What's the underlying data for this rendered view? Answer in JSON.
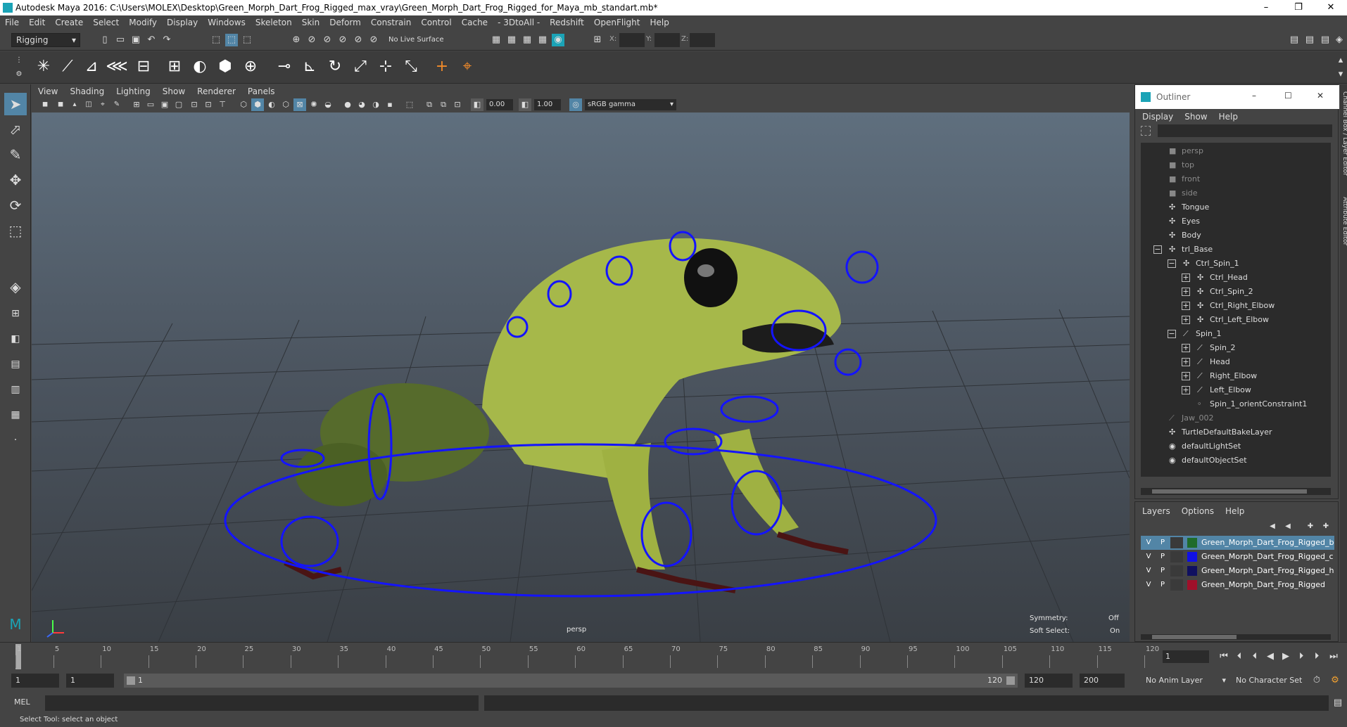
{
  "app": {
    "title": "Autodesk Maya 2016: C:\\Users\\MOLEX\\Desktop\\Green_Morph_Dart_Frog_Rigged_max_vray\\Green_Morph_Dart_Frog_Rigged_for_Maya_mb_standart.mb*",
    "window_controls": [
      "–",
      "❐",
      "✕"
    ]
  },
  "menubar": [
    "File",
    "Edit",
    "Create",
    "Select",
    "Modify",
    "Display",
    "Windows",
    "Skeleton",
    "Skin",
    "Deform",
    "Constrain",
    "Control",
    "Cache",
    "- 3DtoAll -",
    "Redshift",
    "OpenFlight",
    "Help"
  ],
  "statusline": {
    "mode": "Rigging",
    "live_surface": "No Live Surface",
    "x_label": "X:",
    "y_label": "Y:",
    "z_label": "Z:"
  },
  "panel": {
    "menus": [
      "View",
      "Shading",
      "Lighting",
      "Show",
      "Renderer",
      "Panels"
    ],
    "exposure": "0.00",
    "gamma": "1.00",
    "color_space": "sRGB gamma"
  },
  "viewport": {
    "camera_label": "persp",
    "hud": [
      {
        "label": "Symmetry:",
        "value": "Off"
      },
      {
        "label": "Soft Select:",
        "value": "On"
      }
    ]
  },
  "outliner": {
    "title": "Outliner",
    "menus": [
      "Display",
      "Show",
      "Help"
    ],
    "items": [
      {
        "label": "persp",
        "depth": 0,
        "dim": true,
        "icon": "camera-icon"
      },
      {
        "label": "top",
        "depth": 0,
        "dim": true,
        "icon": "camera-icon"
      },
      {
        "label": "front",
        "depth": 0,
        "dim": true,
        "icon": "camera-icon"
      },
      {
        "label": "side",
        "depth": 0,
        "dim": true,
        "icon": "camera-icon"
      },
      {
        "label": "Tongue",
        "depth": 0,
        "dim": false,
        "icon": "transform-icon"
      },
      {
        "label": "Eyes",
        "depth": 0,
        "dim": false,
        "icon": "transform-icon"
      },
      {
        "label": "Body",
        "depth": 0,
        "dim": false,
        "icon": "transform-icon"
      },
      {
        "label": "trl_Base",
        "depth": 0,
        "dim": false,
        "icon": "transform-icon",
        "expander": "−"
      },
      {
        "label": "Ctrl_Spin_1",
        "depth": 1,
        "dim": false,
        "icon": "transform-icon",
        "expander": "−"
      },
      {
        "label": "Ctrl_Head",
        "depth": 2,
        "dim": false,
        "icon": "transform-icon",
        "expander": "+"
      },
      {
        "label": "Ctrl_Spin_2",
        "depth": 2,
        "dim": false,
        "icon": "transform-icon",
        "expander": "+"
      },
      {
        "label": "Ctrl_Right_Elbow",
        "depth": 2,
        "dim": false,
        "icon": "transform-icon",
        "expander": "+"
      },
      {
        "label": "Ctrl_Left_Elbow",
        "depth": 2,
        "dim": false,
        "icon": "transform-icon",
        "expander": "+"
      },
      {
        "label": "Spin_1",
        "depth": 1,
        "dim": false,
        "icon": "joint-icon",
        "expander": "−"
      },
      {
        "label": "Spin_2",
        "depth": 2,
        "dim": false,
        "icon": "joint-icon",
        "expander": "+"
      },
      {
        "label": "Head",
        "depth": 2,
        "dim": false,
        "icon": "joint-icon",
        "expander": "+"
      },
      {
        "label": "Right_Elbow",
        "depth": 2,
        "dim": false,
        "icon": "joint-icon",
        "expander": "+"
      },
      {
        "label": "Left_Elbow",
        "depth": 2,
        "dim": false,
        "icon": "joint-icon",
        "expander": "+"
      },
      {
        "label": "Spin_1_orientConstraint1",
        "depth": 2,
        "dim": false,
        "icon": "constraint-icon"
      },
      {
        "label": "Jaw_002",
        "depth": 0,
        "dim": true,
        "icon": "joint-icon"
      },
      {
        "label": "TurtleDefaultBakeLayer",
        "depth": 0,
        "dim": false,
        "icon": "transform-icon"
      },
      {
        "label": "defaultLightSet",
        "depth": 0,
        "dim": false,
        "icon": "set-icon"
      },
      {
        "label": "defaultObjectSet",
        "depth": 0,
        "dim": false,
        "icon": "set-icon"
      }
    ]
  },
  "layers": {
    "menus": [
      "Layers",
      "Options",
      "Help"
    ],
    "rows": [
      {
        "v": "V",
        "p": "P",
        "color": "#1f6b2a",
        "name": "Green_Morph_Dart_Frog_Rigged_b",
        "selected": true
      },
      {
        "v": "V",
        "p": "P",
        "color": "#1010e6",
        "name": "Green_Morph_Dart_Frog_Rigged_c",
        "selected": false
      },
      {
        "v": "V",
        "p": "P",
        "color": "#101060",
        "name": "Green_Morph_Dart_Frog_Rigged_h",
        "selected": false
      },
      {
        "v": "V",
        "p": "P",
        "color": "#a0102a",
        "name": "Green_Morph_Dart_Frog_Rigged",
        "selected": false
      }
    ]
  },
  "side_tabs": [
    "Channel Box / Layer Editor",
    "Attribute Editor"
  ],
  "timeline": {
    "ticks": [
      1,
      5,
      10,
      15,
      20,
      25,
      30,
      35,
      40,
      45,
      50,
      55,
      60,
      65,
      70,
      75,
      80,
      85,
      90,
      95,
      100,
      105,
      110,
      115,
      120
    ],
    "current_frame": "1"
  },
  "range": {
    "start": "1",
    "playback_start": "1",
    "slider_start": "1",
    "slider_end": "120",
    "playback_end": "120",
    "end": "200",
    "anim_layer": "No Anim Layer",
    "character_set": "No Character Set"
  },
  "command": {
    "label": "MEL"
  },
  "help": {
    "text": "Select Tool: select an object"
  },
  "colors": {
    "accent": "#5285a6",
    "manipulator": "#1414ff",
    "frog": "#a6b84a"
  }
}
